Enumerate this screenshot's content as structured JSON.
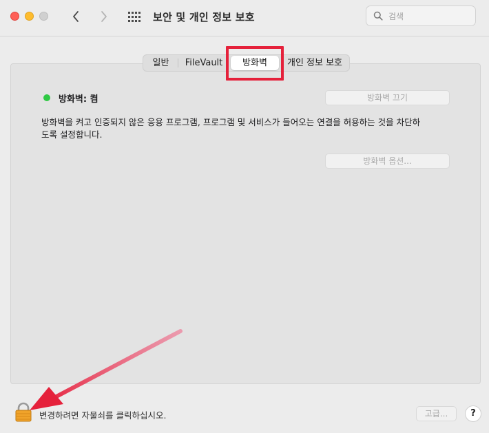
{
  "window": {
    "title": "보안 및 개인 정보 보호",
    "search_placeholder": "검색"
  },
  "tabs": [
    {
      "label": "일반",
      "active": false
    },
    {
      "label": "FileVault",
      "active": false
    },
    {
      "label": "방화벽",
      "active": true
    },
    {
      "label": "개인 정보 보호",
      "active": false
    }
  ],
  "firewall": {
    "status_label": "방화벽: 켬",
    "status_color": "#2fc944",
    "turn_off_button": "방화벽 끄기",
    "description": "방화벽을 켜고 인증되지 않은 응용 프로그램, 프로그램 및 서비스가 들어오는 연결을 허용하는 것을 차단하도록 설정합니다.",
    "options_button": "방화벽 옵션..."
  },
  "footer": {
    "lock_text": "변경하려면 자물쇠를 클릭하십시오.",
    "advanced_button": "고급...",
    "help_button": "?"
  },
  "annotations": {
    "highlight_color": "#e5213b",
    "arrow_color": "#e5213b"
  }
}
